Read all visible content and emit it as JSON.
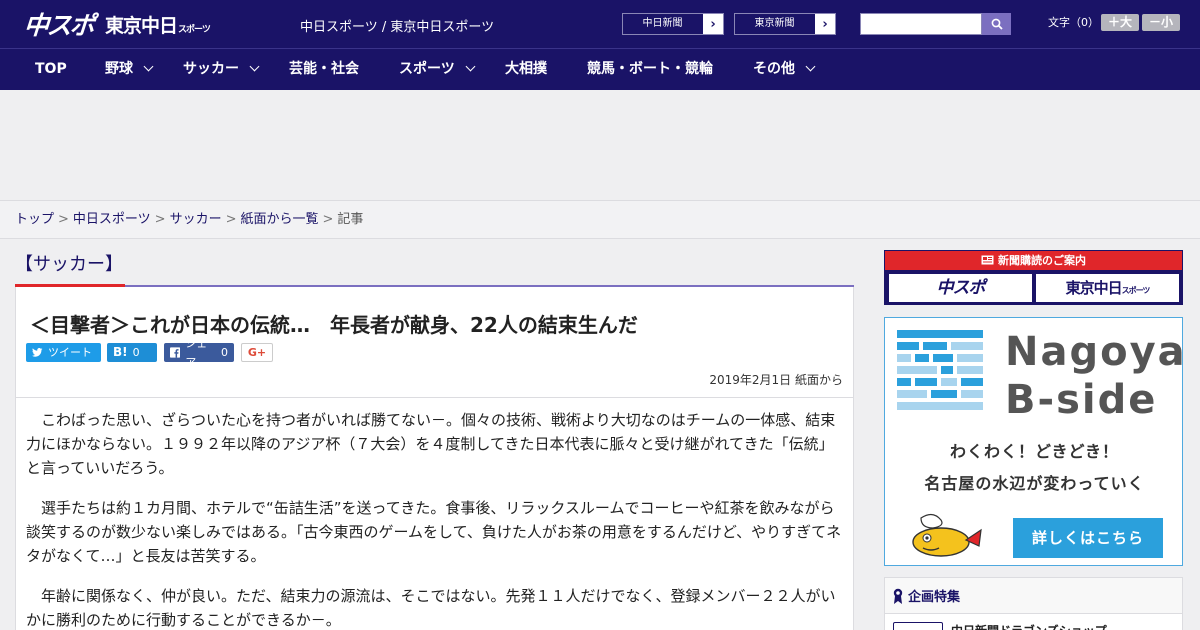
{
  "header": {
    "logo_main": "中スポ",
    "logo_tokyo": "東京中日",
    "logo_tokyo_small": "スポーツ",
    "site_links": "中日スポーツ / 東京中日スポーツ",
    "paper_links": [
      {
        "label": "中日新聞"
      },
      {
        "label": "東京新聞"
      }
    ],
    "search_placeholder": "",
    "font_size_label": "文字（0）",
    "font_larger": "＋大",
    "font_smaller": "－小"
  },
  "nav": [
    {
      "label": "TOP",
      "has_menu": false
    },
    {
      "label": "野球",
      "has_menu": true
    },
    {
      "label": "サッカー",
      "has_menu": true
    },
    {
      "label": "芸能・社会",
      "has_menu": false
    },
    {
      "label": "スポーツ",
      "has_menu": true
    },
    {
      "label": "大相撲",
      "has_menu": false
    },
    {
      "label": "競馬・ボート・競輪",
      "has_menu": false
    },
    {
      "label": "その他",
      "has_menu": true
    }
  ],
  "breadcrumb": {
    "items": [
      "トップ",
      "中日スポーツ",
      "サッカー",
      "紙面から一覧"
    ],
    "current": "記事"
  },
  "article": {
    "category": "【サッカー】",
    "title": "＜目撃者＞これが日本の伝統…　年長者が献身、22人の結束生んだ",
    "share": {
      "tweet": "ツイート",
      "hatena_label": "B!",
      "hatena_count": "0",
      "fb_label": "シェア",
      "fb_count": "0",
      "gplus": "G+"
    },
    "date": "2019年2月1日 紙面から",
    "paragraphs": [
      "こわばった思い、ざらついた心を持つ者がいれば勝てない－。個々の技術、戦術より大切なのはチームの一体感、結束力にほかならない。１９９２年以降のアジア杯（７大会）を４度制してきた日本代表に脈々と受け継がれてきた「伝統」と言っていいだろう。",
      "選手たちは約１カ月間、ホテルで“缶詰生活”を送ってきた。食事後、リラックスルームでコーヒーや紅茶を飲みながら談笑するのが数少ない楽しみではある。「古今東西のゲームをして、負けた人がお茶の用意をするんだけど、やりすぎてネタがなくて…」と長友は苦笑する。",
      "年齢に関係なく、仲が良い。ただ、結束力の源流は、そこではない。先発１１人だけでなく、登録メンバー２２人がいかに勝利のために行動することができるか－。"
    ]
  },
  "sidebar": {
    "subscribe_head": "新聞購読のご案内",
    "subscribe_logo1": "中スポ",
    "subscribe_logo2": "東京中日",
    "subscribe_logo2_small": "スポーツ",
    "bside_line1": "Nagoya",
    "bside_line2": "B-side",
    "bside_tag1": "わくわく！どきどき！",
    "bside_tag2": "名古屋の水辺が変わっていく",
    "bside_button": "詳しくはこちら",
    "feature_head": "企画特集",
    "feature_item": "中日新聞ドラゴンズショップ"
  },
  "colors": {
    "brand_navy": "#1a1367",
    "accent_red": "#e0262a",
    "accent_purple": "#7b6fc0",
    "twitter": "#1e9ce8",
    "hatena": "#1e8ed6",
    "facebook": "#3b5a9c",
    "bside_blue": "#2ba0dc"
  }
}
